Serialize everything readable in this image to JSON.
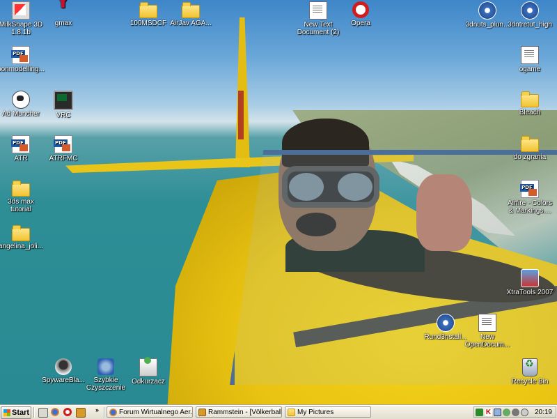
{
  "desktop_icons": [
    {
      "id": "milkshape",
      "label": "MilkShape 3D\n1.8.1b",
      "icon": "milkshape-icon"
    },
    {
      "id": "gmax",
      "label": "gmax",
      "icon": "gmax-icon"
    },
    {
      "id": "100msdcf",
      "label": "100MSDCF",
      "icon": "folder-icon"
    },
    {
      "id": "airjav",
      "label": "AirJav AGA...",
      "icon": "folder-icon"
    },
    {
      "id": "newtext",
      "label": "New Text\nDocument (2)",
      "icon": "text-document-icon"
    },
    {
      "id": "opera",
      "label": "Opera",
      "icon": "opera-icon"
    },
    {
      "id": "3dnuts",
      "label": "3dnuts_plun...",
      "icon": "media-file-icon"
    },
    {
      "id": "3dntretut",
      "label": "3dntretut_high",
      "icon": "media-file-icon"
    },
    {
      "id": "bonmodelling",
      "label": "bonmodelling...",
      "icon": "pdf-icon"
    },
    {
      "id": "ogame",
      "label": "ogame",
      "icon": "text-document-icon"
    },
    {
      "id": "admuncher",
      "label": "Ad Muncher",
      "icon": "cow-icon"
    },
    {
      "id": "vrc",
      "label": "VRC",
      "icon": "vrc-icon"
    },
    {
      "id": "bleach",
      "label": "Bleach",
      "icon": "folder-icon"
    },
    {
      "id": "atr",
      "label": "ATR",
      "icon": "pdf-icon"
    },
    {
      "id": "atrfmc",
      "label": "ATRFMC",
      "icon": "pdf-icon"
    },
    {
      "id": "dozgrania",
      "label": "do zgrania",
      "icon": "folder-icon"
    },
    {
      "id": "3dsmax",
      "label": "3ds max\ntutorial",
      "icon": "folder-icon"
    },
    {
      "id": "airfire",
      "label": "Airfire - Colors\n& Markings....",
      "icon": "pdf-icon"
    },
    {
      "id": "angelina",
      "label": "angelina_joli...",
      "icon": "folder-icon"
    },
    {
      "id": "xtratools",
      "label": "XtraTools 2007",
      "icon": "xtratools-icon"
    },
    {
      "id": "rund",
      "label": "Rund3nstall...",
      "icon": "media-file-icon"
    },
    {
      "id": "newopendoc",
      "label": "New\nOpenDocum...",
      "icon": "text-document-icon"
    },
    {
      "id": "spyware",
      "label": "SpywareBla...",
      "icon": "spyware-icon"
    },
    {
      "id": "szybkie",
      "label": "Szybkie\nCzyszczenie",
      "icon": "cleanup-icon"
    },
    {
      "id": "odkurzacz",
      "label": "Odkurzacz",
      "icon": "vacuum-icon"
    },
    {
      "id": "recycle",
      "label": "Recycle Bin",
      "icon": "recycle-bin-icon"
    }
  ],
  "taskbar": {
    "start_label": "Start",
    "quick_launch": [
      "show-desktop-icon",
      "firefox-icon",
      "opera-icon",
      "media-player-icon"
    ],
    "overflow_label": "»",
    "buttons": [
      {
        "label": "Forum Wirtualnego Aer...",
        "icon": "firefox-icon"
      },
      {
        "label": "Rammstein - [Völkerball ...",
        "icon": "media-player-icon"
      },
      {
        "label": "My Pictures",
        "icon": "folder-icon"
      }
    ],
    "tray_icons": [
      "winamp-icon",
      "kaspersky-icon",
      "network-icon",
      "volume-icon",
      "security-icon",
      "speaker-icon"
    ],
    "clock": "20:19"
  }
}
